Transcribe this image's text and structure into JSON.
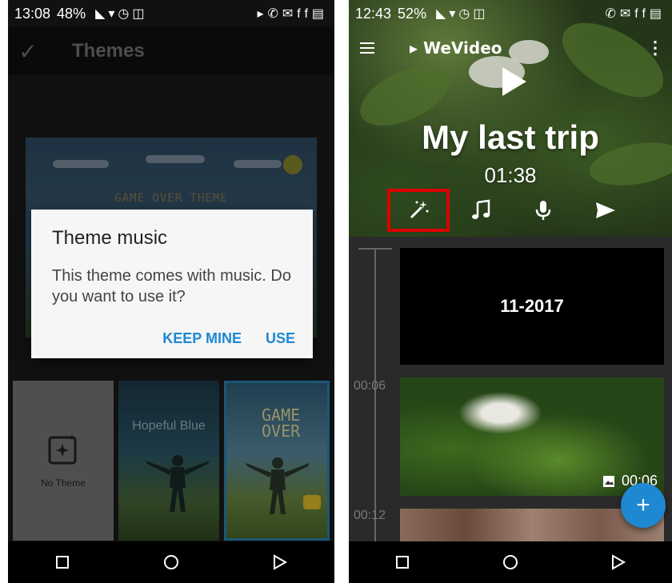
{
  "left_phone": {
    "status": {
      "time": "13:08",
      "battery": "48%"
    },
    "appbar": {
      "title": "Themes"
    },
    "preview": {
      "title": "GAME OVER THEME"
    },
    "dialog": {
      "title": "Theme music",
      "message": "This theme comes with music. Do you want to use it?",
      "keep_label": "KEEP MINE",
      "use_label": "USE"
    },
    "themes": [
      {
        "label": "No Theme"
      },
      {
        "label": "Hopeful Blue"
      },
      {
        "label": "GAME OVER"
      }
    ]
  },
  "right_phone": {
    "status": {
      "time": "12:43",
      "battery": "52%"
    },
    "logo": "WeVideo",
    "project_title": "My last trip",
    "duration": "01:38",
    "tools": [
      "theme",
      "music",
      "voiceover",
      "share"
    ],
    "timeline": {
      "times": [
        "00:06",
        "00:12"
      ],
      "text_clip": "11-2017",
      "photo_clip_duration": "00:06"
    },
    "fab_label": "+"
  },
  "colors": {
    "accent": "#1e88d2",
    "highlight": "#dd0000"
  }
}
